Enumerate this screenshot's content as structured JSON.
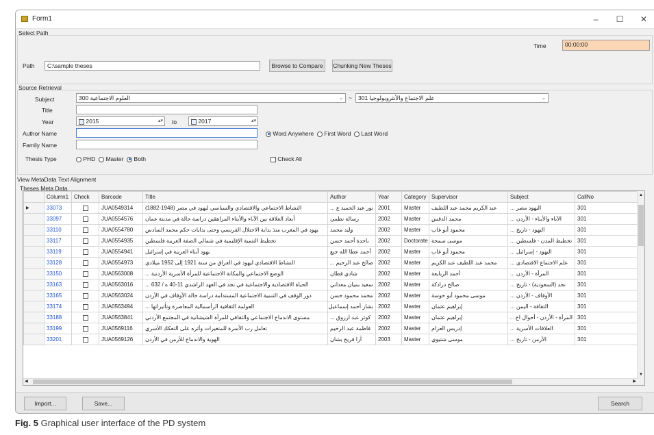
{
  "window": {
    "title": "Form1",
    "minimize": "–",
    "maximize": "☐",
    "close": "✕"
  },
  "path_section": {
    "label": "Select Path",
    "path_label": "Path",
    "path_value": "C:\\sample theses",
    "browse_button": "Browse to Compare",
    "chunking_button": "Chunking New Theses",
    "time_label": "Time",
    "time_value": "00:00:00"
  },
  "source": {
    "label": "Source Retrieval",
    "subject_label": "Subject",
    "subject_value": "300 العلوم الاجتماعية",
    "subject2_value": "301 علم الاجتماع والأنثروبولوجيا",
    "title_label": "Title",
    "title_value": "",
    "year_label": "Year",
    "year_from": "2015",
    "year_to_label": "to",
    "year_to": "2017",
    "author_label": "Author Name",
    "author_value": "",
    "family_label": "Family Name",
    "family_value": "",
    "word_options": [
      "Word Anywhere",
      "First Word",
      "Last Word"
    ],
    "word_selected": "Word Anywhere",
    "thesis_type_label": "Thesis Type",
    "thesis_types": [
      "PHD",
      "Master",
      "Both"
    ],
    "thesis_selected": "Both",
    "check_all": "Check All"
  },
  "tabs": [
    "View MetaData",
    "Text Alignment"
  ],
  "grid_label": "Theses Meta Data",
  "columns": [
    "Column1",
    "Check",
    "Barcode",
    "Title",
    "Author",
    "Year",
    "Category",
    "Supervisor",
    "Subject",
    "CallNo"
  ],
  "rows": [
    [
      "33073",
      "JUA0549314",
      "النشاط الاجتماعي والاقتصادي والسياسي ليهود في مصر (1948-1882)",
      "نور عبد الحميد ع ...",
      "2001",
      "Master",
      "عبد الكريم محمد عبد اللطيف",
      "اليهود مصر ...",
      "301"
    ],
    [
      "33097",
      "JUA0554576",
      "أبعاد العلاقة بين الآباء والأبناء المراهقين دراسة حالة في مدينة عمان",
      "رسالة نظمي",
      "2002",
      "Master",
      "محمد الدقس",
      "الآباء والأبناء - الأردن ...",
      "301"
    ],
    [
      "33110",
      "JUA0554780",
      "يهود في المغرب منذ بداية الاحتلال الفرنسي وحتى بدايات حكم محمد السادس",
      "وليد محمد",
      "2002",
      "Master",
      "محمود أبو غاب",
      "اليهود - تاريخ ...",
      "301"
    ],
    [
      "33117",
      "JUA0554935",
      "تخطيط التنمية الإقليمية في شمالي الضفة الغربية فلسطين",
      "باجدة أحمد حسن",
      "2002",
      "Doctorate",
      "موسى سمحة",
      "تخطيط المدن - فلسطين ...",
      "301"
    ],
    [
      "33119",
      "JUA0554941",
      "يهود أبناء العربية في إسرائيل",
      "أحمد عطا الله جبع",
      "2002",
      "Master",
      "محمود أبو غاب",
      "اليهود - إسرائيل ...",
      "301"
    ],
    [
      "33128",
      "JUA0554973",
      "النشاط الاقتصادي ليهود في العراق من سنة 1921 إلى 1952 ميلادي",
      "صالح عبد الرحيم ...",
      "2002",
      "Master",
      "محمد عبد اللطيف عبد الكريم",
      "علم الاجتماع الاقتصادي ...",
      "301"
    ],
    [
      "33150",
      "JUA0563008",
      "الوضع الاجتماعي والمكانة الاجتماعية للمرأة الأسرية الأردنية ...",
      "شادي قطان",
      "2002",
      "Master",
      "أحمد الربايعة",
      "المرأة - الأردن ...",
      "301"
    ],
    [
      "33163",
      "JUA0563016",
      "الحياة الاقتصادية والاجتماعية في نجد في العهد الراشدي 11-40 ه / 632 ...",
      "سعيد بميان معداني",
      "2002",
      "Master",
      "صالح درادكة",
      "نجد (السعودية) - تاريخ ...",
      "301"
    ],
    [
      "33165",
      "JUA0563024",
      "دور الوقف في التنمية الاجتماعية المستدامة دراسة حالة الأوقاف في الأردن",
      "محمد محمود حسن",
      "2002",
      "Master",
      "موسى محمود أبو حوسة",
      "الأوقاف - الأردن ...",
      "301"
    ],
    [
      "33174",
      "JUA0563494",
      "العولمة الثقافية الرأسمالية المعاصرة وتأثيراتها ...",
      "بشار أحمد إسماعيل",
      "2002",
      "Master",
      "إبراهيم عثمان",
      "الثقافة - اليمن ...",
      "301"
    ],
    [
      "33188",
      "JUA0563841",
      "مستوى الاندماج الاجتماعي والثقافي للمرأة الشيشانية في المجتمع الأردني",
      "كوثر عبد ارزوق ...",
      "2002",
      "Master",
      "إبراهيم عثمان",
      "المرأة - الأردن - أحوال اج ...",
      "301"
    ],
    [
      "33199",
      "JUA0569116",
      "تعامل رب الأسرة للمتغيرات وأثره على التفكك الأسري",
      "فاطمة عبد الرحيم",
      "2002",
      "Master",
      "إدريس العزام",
      "العلاقات الأسرية ...",
      "301"
    ],
    [
      "33201",
      "JUA0569126",
      "الهوية والاندماج للأرمن في الأردن",
      "آرا فريج بشان",
      "2003",
      "Master",
      "موسى شتيوي",
      "الأرمن - تاريخ ...",
      "301"
    ]
  ],
  "bottom": {
    "import_button": "Import...",
    "save_button": "Save...",
    "search_button": "Search"
  },
  "caption": {
    "label": "Fig. 5",
    "text": "Graphical user interface of the PD system"
  },
  "colors": {
    "time_bg": "#fbd7b5",
    "row_num": "#1a4fd0",
    "window_bg": "#f0f0f0"
  }
}
